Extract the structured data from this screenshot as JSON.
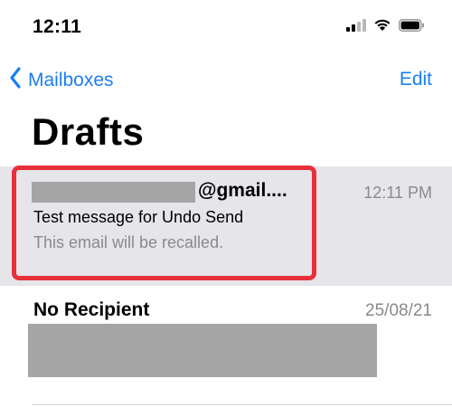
{
  "status_bar": {
    "time": "12:11",
    "icons": [
      "cellular-signal-icon",
      "wifi-icon",
      "battery-icon"
    ]
  },
  "nav": {
    "back_label": "Mailboxes",
    "edit_label": "Edit",
    "back_icon": "chevron-left-icon",
    "accent_color": "#1a7ef5"
  },
  "title": "Drafts",
  "messages": [
    {
      "sender_suffix": "@gmail....",
      "time": "12:11 PM",
      "subject": "Test message for Undo Send",
      "preview": "This email will be recalled.",
      "selected": true
    },
    {
      "sender": "No Recipient",
      "date": "25/08/21"
    }
  ],
  "colors": {
    "highlight_border": "#e8303a",
    "selected_row_bg": "#e5e5ea",
    "redaction": "#a5a5a5",
    "secondary_text": "#8a8a8e"
  }
}
